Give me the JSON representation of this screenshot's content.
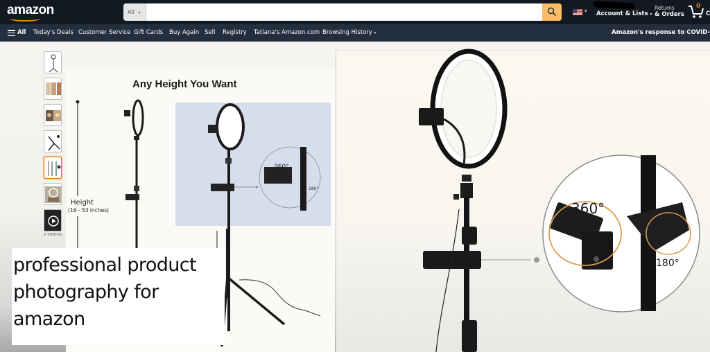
{
  "header": {
    "logo": "amazon",
    "search": {
      "category": "All",
      "placeholder": "",
      "value": ""
    },
    "locale_flag": "us-flag-icon",
    "account_label": "Account & Lists",
    "returns_top": "Returns",
    "returns_bottom": "& Orders",
    "cart_count": "0",
    "cart_label_partial": "C"
  },
  "nav": {
    "all_label": "All",
    "items": [
      {
        "label": "Today's Deals"
      },
      {
        "label": "Customer Service"
      },
      {
        "label": "Gift Cards"
      },
      {
        "label": "Buy Again"
      },
      {
        "label": "Sell"
      },
      {
        "label": "Registry"
      },
      {
        "label": "Tatiana's Amazon.com"
      },
      {
        "label": "Browsing History"
      }
    ],
    "covid_label": "Amazon's response to COVID-"
  },
  "gallery": {
    "thumbnails": [
      {
        "alt": "tripod ring light"
      },
      {
        "alt": "lighting comparison"
      },
      {
        "alt": "portrait comparison"
      },
      {
        "alt": "tripod legs"
      },
      {
        "alt": "height diagram",
        "selected": true
      },
      {
        "alt": "use scene"
      },
      {
        "alt": "video",
        "video": true
      }
    ],
    "videos_label": "2 VIDEOS"
  },
  "main_image": {
    "title": "Any Height You Want",
    "height_label": "Height",
    "height_range": "(16 - 53 inches)",
    "inset_rotation_small_360": "360°",
    "inset_rotation_small_180": "180°"
  },
  "zoom_image": {
    "rotation_360": "360°",
    "rotation_180": "180°"
  },
  "overlay": {
    "caption": "professional product\nphotography for\namazon"
  },
  "colors": {
    "topbar": "#131921",
    "navbar": "#232f3e",
    "search_button": "#febd69",
    "accent": "#f08804",
    "rotation_arrows": "#d99a4e"
  }
}
